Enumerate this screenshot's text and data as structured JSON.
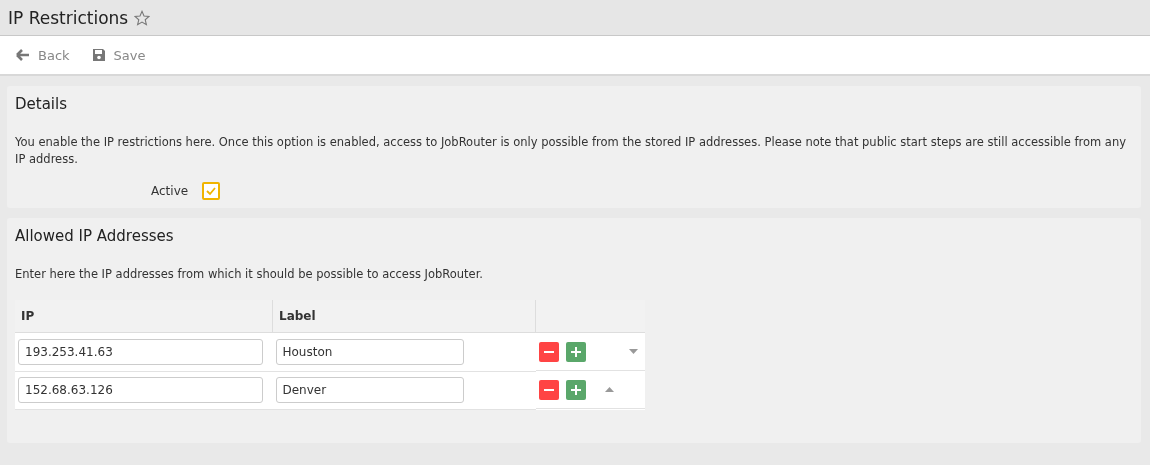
{
  "page": {
    "title": "IP Restrictions",
    "favorite": false
  },
  "toolbar": [
    {
      "kind": "back",
      "label": "Back"
    },
    {
      "kind": "save",
      "label": "Save"
    }
  ],
  "details": {
    "heading": "Details",
    "description": "You enable the IP restrictions here. Once this option is enabled, access to JobRouter is only possible from the stored IP addresses. Please note that public start steps are still accessible from any IP address.",
    "active": {
      "label": "Active",
      "checked": true
    }
  },
  "allowed": {
    "heading": "Allowed IP Addresses",
    "description": "Enter here the IP addresses from which it should be possible to access JobRouter.",
    "columns": [
      "IP",
      "Label"
    ],
    "rows": [
      {
        "ip": "193.253.41.63",
        "label": "Houston",
        "kind": "move_down"
      },
      {
        "ip": "152.68.63.126",
        "label": "Denver",
        "kind": "move_up"
      }
    ]
  }
}
